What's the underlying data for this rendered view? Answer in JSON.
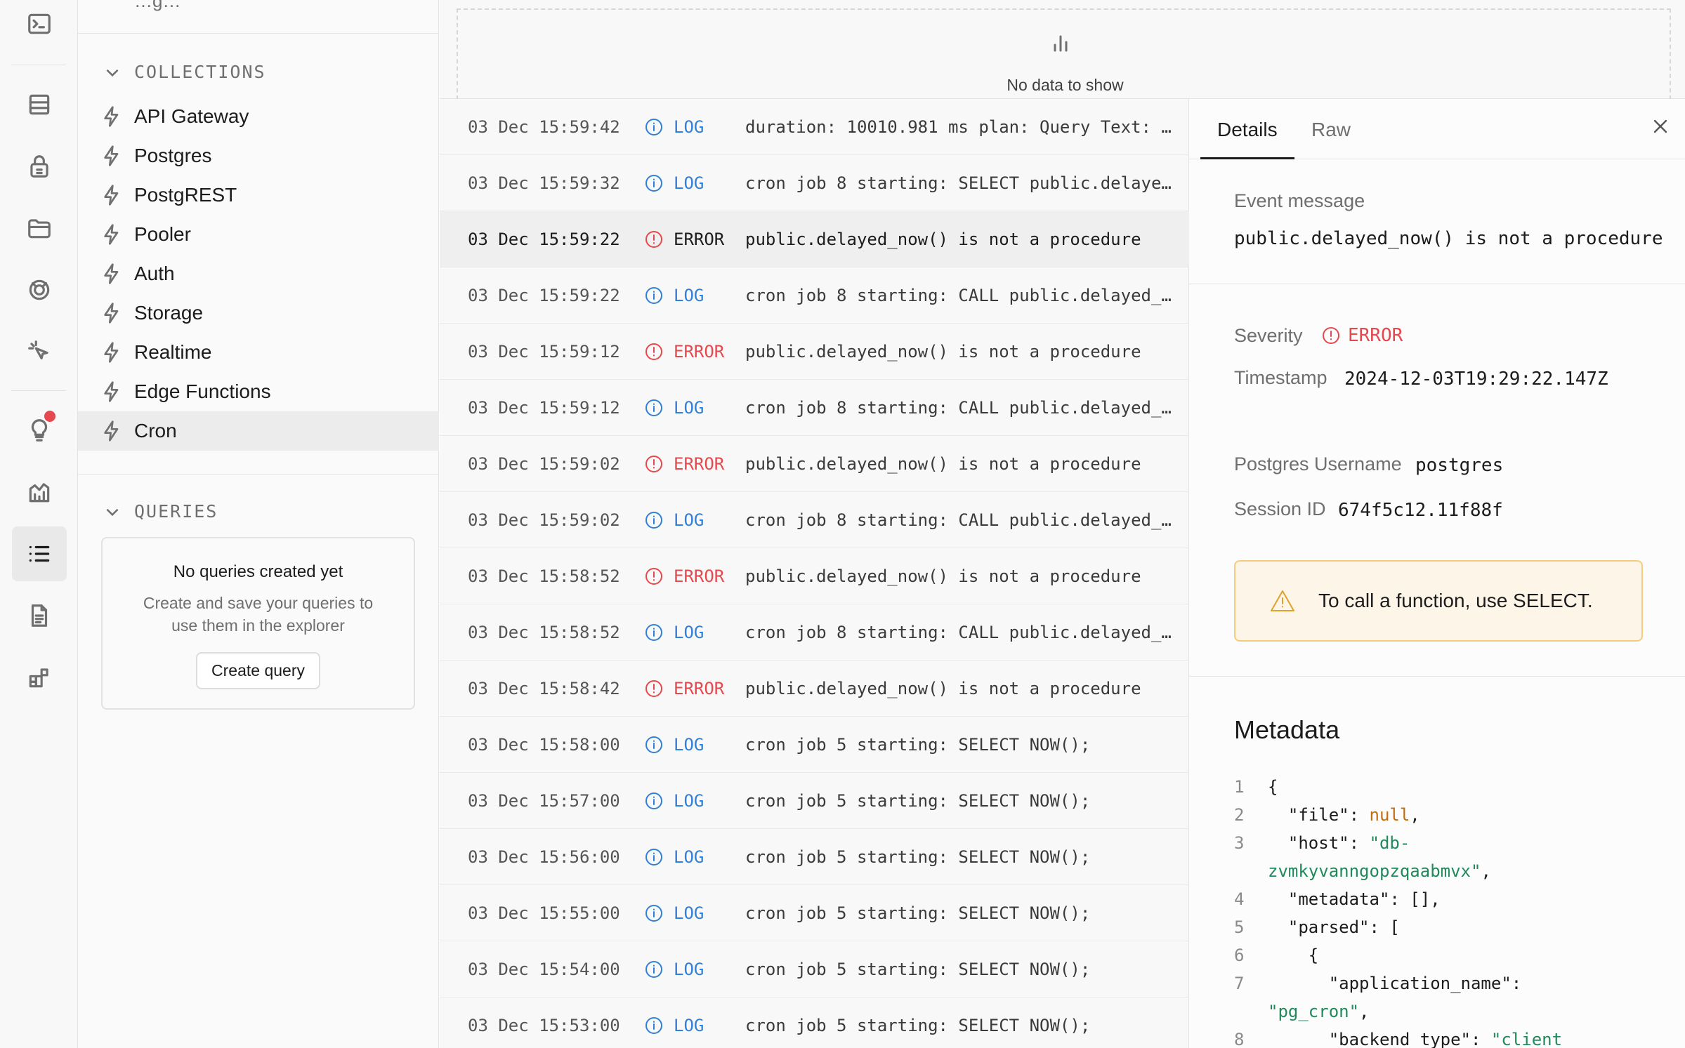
{
  "sidebar": {
    "top_fragment": "…g…",
    "collections_heading": "COLLECTIONS",
    "collections": [
      {
        "label": "API Gateway"
      },
      {
        "label": "Postgres"
      },
      {
        "label": "PostgREST"
      },
      {
        "label": "Pooler"
      },
      {
        "label": "Auth"
      },
      {
        "label": "Storage"
      },
      {
        "label": "Realtime"
      },
      {
        "label": "Edge Functions"
      },
      {
        "label": "Cron",
        "active": true
      }
    ],
    "queries_heading": "QUERIES",
    "queries_empty_title": "No queries created yet",
    "queries_empty_desc": "Create and save your queries to use them in the explorer",
    "create_query_label": "Create query"
  },
  "chart": {
    "message": "No data to show"
  },
  "logs": [
    {
      "timestamp": "03 Dec 15:59:42",
      "level": "LOG",
      "message": "duration: 10010.981 ms plan: Query Text: S..."
    },
    {
      "timestamp": "03 Dec 15:59:32",
      "level": "LOG",
      "message": "cron job 8 starting: SELECT public.delayed..."
    },
    {
      "timestamp": "03 Dec 15:59:22",
      "level": "ERROR",
      "message": "public.delayed_now() is not a procedure",
      "selected": true
    },
    {
      "timestamp": "03 Dec 15:59:22",
      "level": "LOG",
      "message": "cron job 8 starting: CALL public.delayed_n..."
    },
    {
      "timestamp": "03 Dec 15:59:12",
      "level": "ERROR",
      "message": "public.delayed_now() is not a procedure"
    },
    {
      "timestamp": "03 Dec 15:59:12",
      "level": "LOG",
      "message": "cron job 8 starting: CALL public.delayed_n..."
    },
    {
      "timestamp": "03 Dec 15:59:02",
      "level": "ERROR",
      "message": "public.delayed_now() is not a procedure"
    },
    {
      "timestamp": "03 Dec 15:59:02",
      "level": "LOG",
      "message": "cron job 8 starting: CALL public.delayed_n..."
    },
    {
      "timestamp": "03 Dec 15:58:52",
      "level": "ERROR",
      "message": "public.delayed_now() is not a procedure"
    },
    {
      "timestamp": "03 Dec 15:58:52",
      "level": "LOG",
      "message": "cron job 8 starting: CALL public.delayed_n..."
    },
    {
      "timestamp": "03 Dec 15:58:42",
      "level": "ERROR",
      "message": "public.delayed_now() is not a procedure"
    },
    {
      "timestamp": "03 Dec 15:58:00",
      "level": "LOG",
      "message": "cron job 5 starting: SELECT NOW();"
    },
    {
      "timestamp": "03 Dec 15:57:00",
      "level": "LOG",
      "message": "cron job 5 starting: SELECT NOW();"
    },
    {
      "timestamp": "03 Dec 15:56:00",
      "level": "LOG",
      "message": "cron job 5 starting: SELECT NOW();"
    },
    {
      "timestamp": "03 Dec 15:55:00",
      "level": "LOG",
      "message": "cron job 5 starting: SELECT NOW();"
    },
    {
      "timestamp": "03 Dec 15:54:00",
      "level": "LOG",
      "message": "cron job 5 starting: SELECT NOW();"
    },
    {
      "timestamp": "03 Dec 15:53:00",
      "level": "LOG",
      "message": "cron job 5 starting: SELECT NOW();"
    }
  ],
  "details": {
    "tabs": [
      "Details",
      "Raw"
    ],
    "event_message_label": "Event message",
    "event_message": "public.delayed_now() is not a procedure",
    "severity_label": "Severity",
    "severity": "ERROR",
    "timestamp_label": "Timestamp",
    "timestamp": "2024-12-03T19:29:22.147Z",
    "username_label": "Postgres Username",
    "username": "postgres",
    "session_label": "Session ID",
    "session_id": "674f5c12.11f88f",
    "hint": "To call a function, use SELECT.",
    "metadata_title": "Metadata"
  },
  "metadata_lines": [
    {
      "n": "1",
      "parts": [
        {
          "t": "{",
          "c": ""
        }
      ]
    },
    {
      "n": "2",
      "parts": [
        {
          "t": "  \"file\": ",
          "c": ""
        },
        {
          "t": "null",
          "c": "c-null"
        },
        {
          "t": ",",
          "c": ""
        }
      ]
    },
    {
      "n": "3",
      "parts": [
        {
          "t": "  \"host\": ",
          "c": ""
        },
        {
          "t": "\"db-",
          "c": "c-str"
        }
      ]
    },
    {
      "n": "",
      "parts": [
        {
          "t": "zvmkyvanngopzqaabmvx\"",
          "c": "c-str"
        },
        {
          "t": ",",
          "c": ""
        }
      ]
    },
    {
      "n": "4",
      "parts": [
        {
          "t": "  \"metadata\": [],",
          "c": ""
        }
      ]
    },
    {
      "n": "5",
      "parts": [
        {
          "t": "  \"parsed\": [",
          "c": ""
        }
      ]
    },
    {
      "n": "6",
      "parts": [
        {
          "t": "    {",
          "c": ""
        }
      ]
    },
    {
      "n": "7",
      "parts": [
        {
          "t": "      \"application_name\":",
          "c": ""
        }
      ]
    },
    {
      "n": "",
      "parts": [
        {
          "t": "\"pg_cron\"",
          "c": "c-str"
        },
        {
          "t": ",",
          "c": ""
        }
      ]
    },
    {
      "n": "8",
      "parts": [
        {
          "t": "      \"backend_type\": ",
          "c": ""
        },
        {
          "t": "\"client",
          "c": "c-str"
        }
      ]
    }
  ],
  "icons": {
    "rail": [
      "terminal-icon",
      "table-editor-icon",
      "auth-icon",
      "storage-icon",
      "realtime-icon",
      "edge-functions-icon",
      "advisors-icon",
      "reports-icon",
      "logs-icon",
      "docs-icon",
      "integrations-icon"
    ],
    "collection_item": "bolt-icon",
    "log_level_info": "info-circle-icon",
    "log_level_error": "alert-circle-icon",
    "hint": "warning-triangle-icon"
  },
  "colors": {
    "log_blue": "#2f80d8",
    "error_red": "#e5484d",
    "warning_bg": "#fdf6e8",
    "warning_border": "#f5cc7e",
    "json_string": "#1f8a5b",
    "json_null": "#c06d0f"
  }
}
